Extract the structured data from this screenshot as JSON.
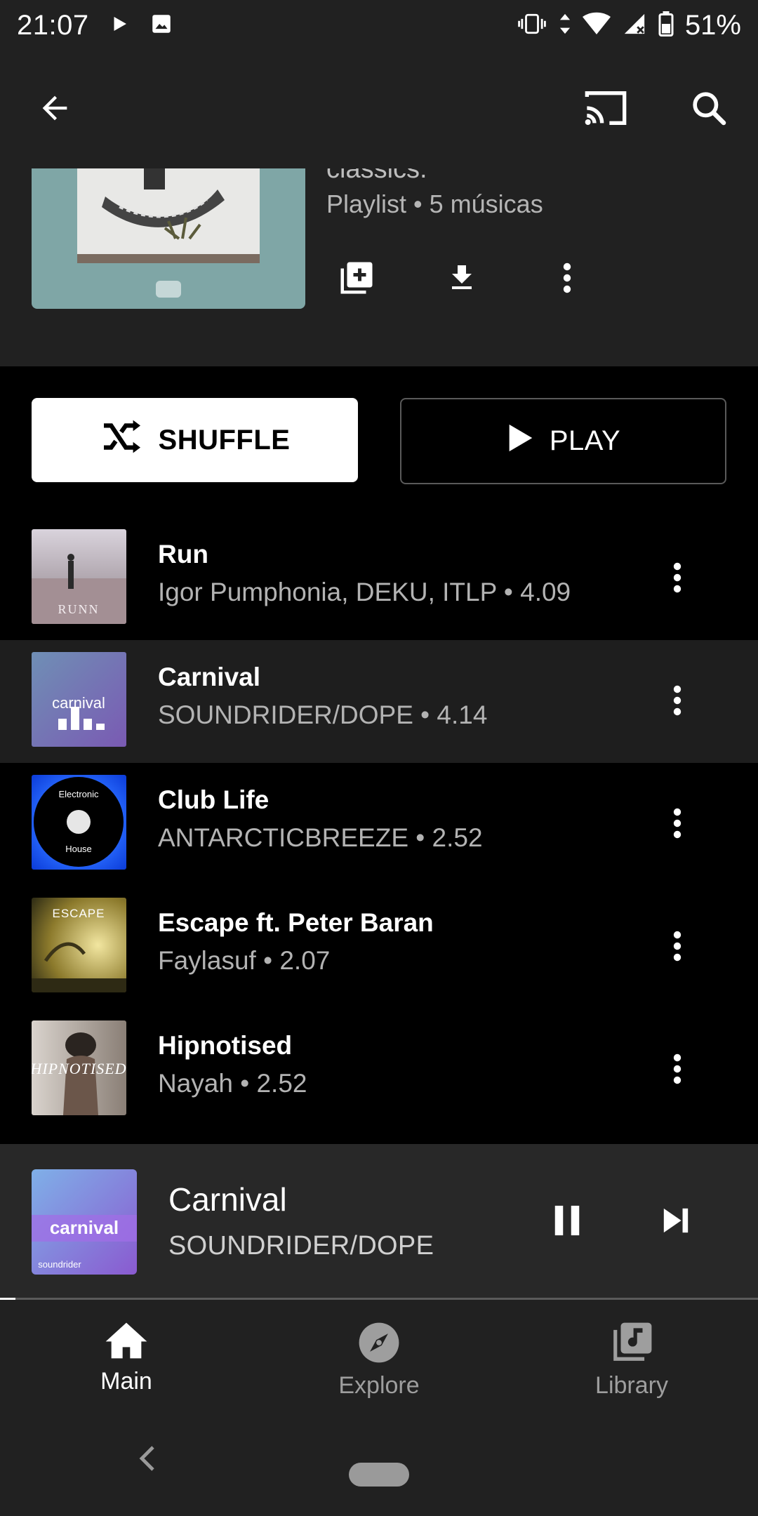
{
  "status_bar": {
    "time": "21:07",
    "battery": "51%",
    "icons": [
      "play-icon",
      "image-icon",
      "vibrate-icon",
      "data-arrows-icon",
      "wifi-icon",
      "signal-icon",
      "battery-icon"
    ]
  },
  "app_bar": {
    "icons": [
      "back-arrow-icon",
      "cast-icon",
      "search-icon"
    ]
  },
  "playlist": {
    "subtitle_cut": "classics.",
    "meta": "Playlist • 5 músicas",
    "actions": [
      "add-to-library-icon",
      "download-icon",
      "more-vert-icon"
    ]
  },
  "buttons": {
    "shuffle": "SHUFFLE",
    "play": "PLAY"
  },
  "tracks": [
    {
      "title": "Run",
      "subtitle": "Igor Pumphonia, DEKU, ITLP • 4.09",
      "active": false,
      "thumb_text": "RUNN"
    },
    {
      "title": "Carnival",
      "subtitle": "SOUNDRIDER/DOPE • 4.14",
      "active": true,
      "thumb_text": "carnival"
    },
    {
      "title": "Club Life",
      "subtitle": "ANTARCTICBREEZE • 2.52",
      "active": false,
      "thumb_text_top": "Electronic",
      "thumb_text_bottom": "House"
    },
    {
      "title": "Escape ft. Peter Baran",
      "subtitle": "Faylasuf • 2.07",
      "active": false,
      "thumb_text": "ESCAPE"
    },
    {
      "title": "Hipnotised",
      "subtitle": "Nayah • 2.52",
      "active": false,
      "thumb_text": "HIPNOTISED"
    }
  ],
  "now_playing": {
    "title": "Carnival",
    "artist": "SOUNDRIDER/DOPE",
    "art_text": "carnival",
    "art_sub": "soundrider",
    "progress": 0.02
  },
  "bottom_nav": [
    {
      "label": "Main",
      "icon": "home-icon",
      "active": true
    },
    {
      "label": "Explore",
      "icon": "compass-icon",
      "active": false
    },
    {
      "label": "Library",
      "icon": "library-music-icon",
      "active": false
    }
  ],
  "colors": {
    "background": "#000000",
    "surface": "#212121",
    "active_row": "#1e1e1e",
    "text_secondary": "#b3b3b3"
  }
}
